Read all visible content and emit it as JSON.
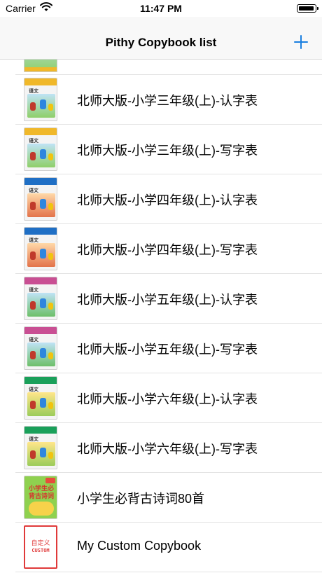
{
  "status_bar": {
    "carrier": "Carrier",
    "time": "11:47 PM"
  },
  "nav": {
    "title": "Pithy Copybook list",
    "add_icon": "plus-icon",
    "accent_color": "#1a7fe0"
  },
  "list": {
    "items": [
      {
        "label": "北师大版-小学三年级(上)-认字表",
        "cover": "yellow"
      },
      {
        "label": "北师大版-小学三年级(上)-写字表",
        "cover": "yellow"
      },
      {
        "label": "北师大版-小学四年级(上)-认字表",
        "cover": "blue"
      },
      {
        "label": "北师大版-小学四年级(上)-写字表",
        "cover": "blue"
      },
      {
        "label": "北师大版-小学五年级(上)-认字表",
        "cover": "pink"
      },
      {
        "label": "北师大版-小学五年级(上)-写字表",
        "cover": "pink"
      },
      {
        "label": "北师大版-小学六年级(上)-认字表",
        "cover": "green"
      },
      {
        "label": "北师大版-小学六年级(上)-写字表",
        "cover": "green"
      },
      {
        "label": "小学生必背古诗词80首",
        "cover": "poem"
      },
      {
        "label": "My Custom Copybook",
        "cover": "custom"
      }
    ],
    "cover_text": {
      "textbook_tag": "语文",
      "poem_title": "小学生必背古诗词",
      "custom_line1": "自定义",
      "custom_line2": "CUSTOM"
    }
  }
}
